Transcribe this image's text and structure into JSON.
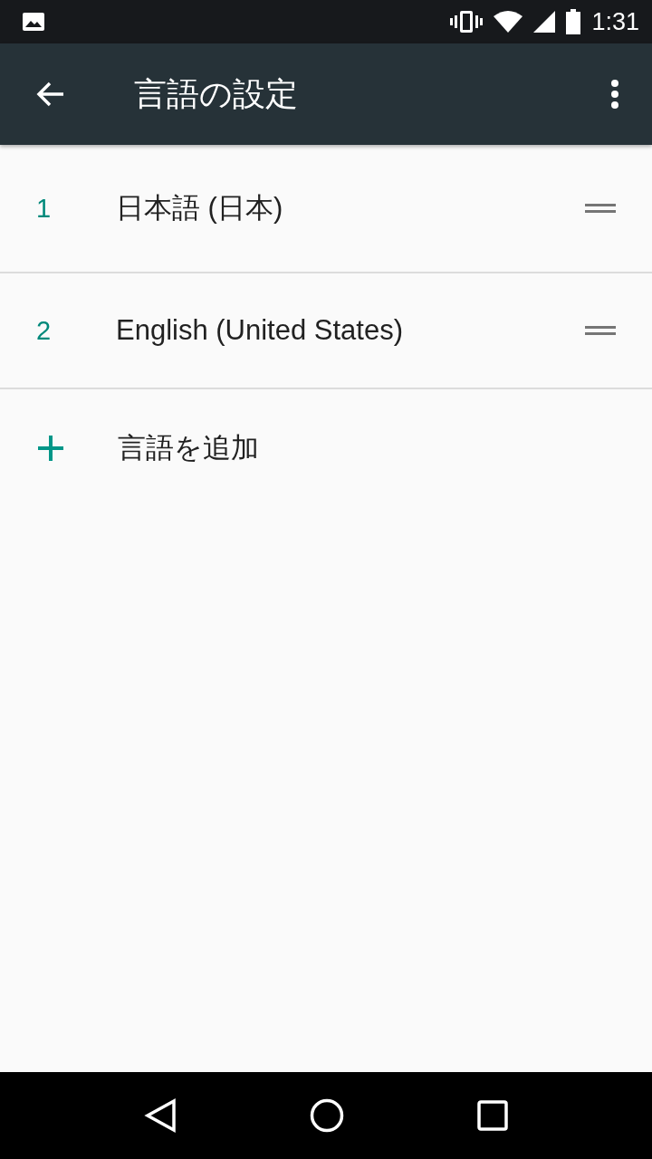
{
  "status_bar": {
    "time": "1:31"
  },
  "toolbar": {
    "title": "言語の設定"
  },
  "languages": [
    {
      "number": "1",
      "name": "日本語 (日本)"
    },
    {
      "number": "2",
      "name": "English (United States)"
    }
  ],
  "add_language": {
    "label": "言語を追加"
  }
}
